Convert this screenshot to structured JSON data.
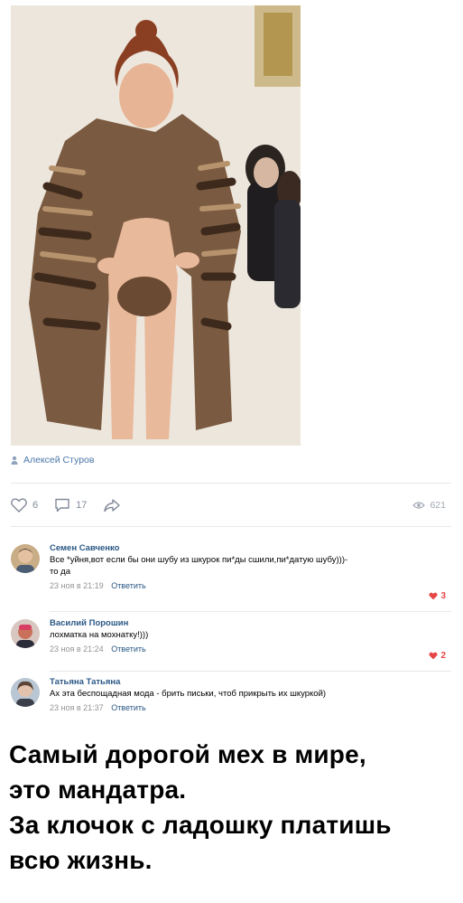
{
  "post": {
    "author": "Алексей Стуров",
    "likes": "6",
    "comments": "17",
    "views": "621"
  },
  "comments": [
    {
      "name": "Семен Савченко",
      "text_line1": "Все *уйня,вот если бы они шубу из шкурок пи*ды сшили,пи*датую шубу)))-",
      "text_line2": "то да",
      "time": "23 ноя в 21:19",
      "reply": "Ответить",
      "likes": "3"
    },
    {
      "name": "Василий Порошин",
      "text_line1": "лохматка на мохнатку!)))",
      "time": "23 ноя в 21:24",
      "reply": "Ответить",
      "likes": "2"
    },
    {
      "name": "Татьяна Татьяна",
      "text_line1": "Ах эта беспощадная мода - брить письки, чтоб прикрыть их шкуркой)",
      "time": "23 ноя в 21:37",
      "reply": "Ответить"
    }
  ],
  "caption": {
    "line1": "Самый дорогой мех в мире,",
    "line2": "это мандатра.",
    "line3": "За клочок с ладошку платишь",
    "line4": "всю жизнь."
  },
  "colors": {
    "link": "#2a5885",
    "author_link": "#4a76a8",
    "muted": "#939393",
    "like_red": "#e64646"
  },
  "icons": [
    "user-icon",
    "heart-icon",
    "comment-icon",
    "share-icon",
    "eye-icon",
    "heart-filled-icon"
  ]
}
